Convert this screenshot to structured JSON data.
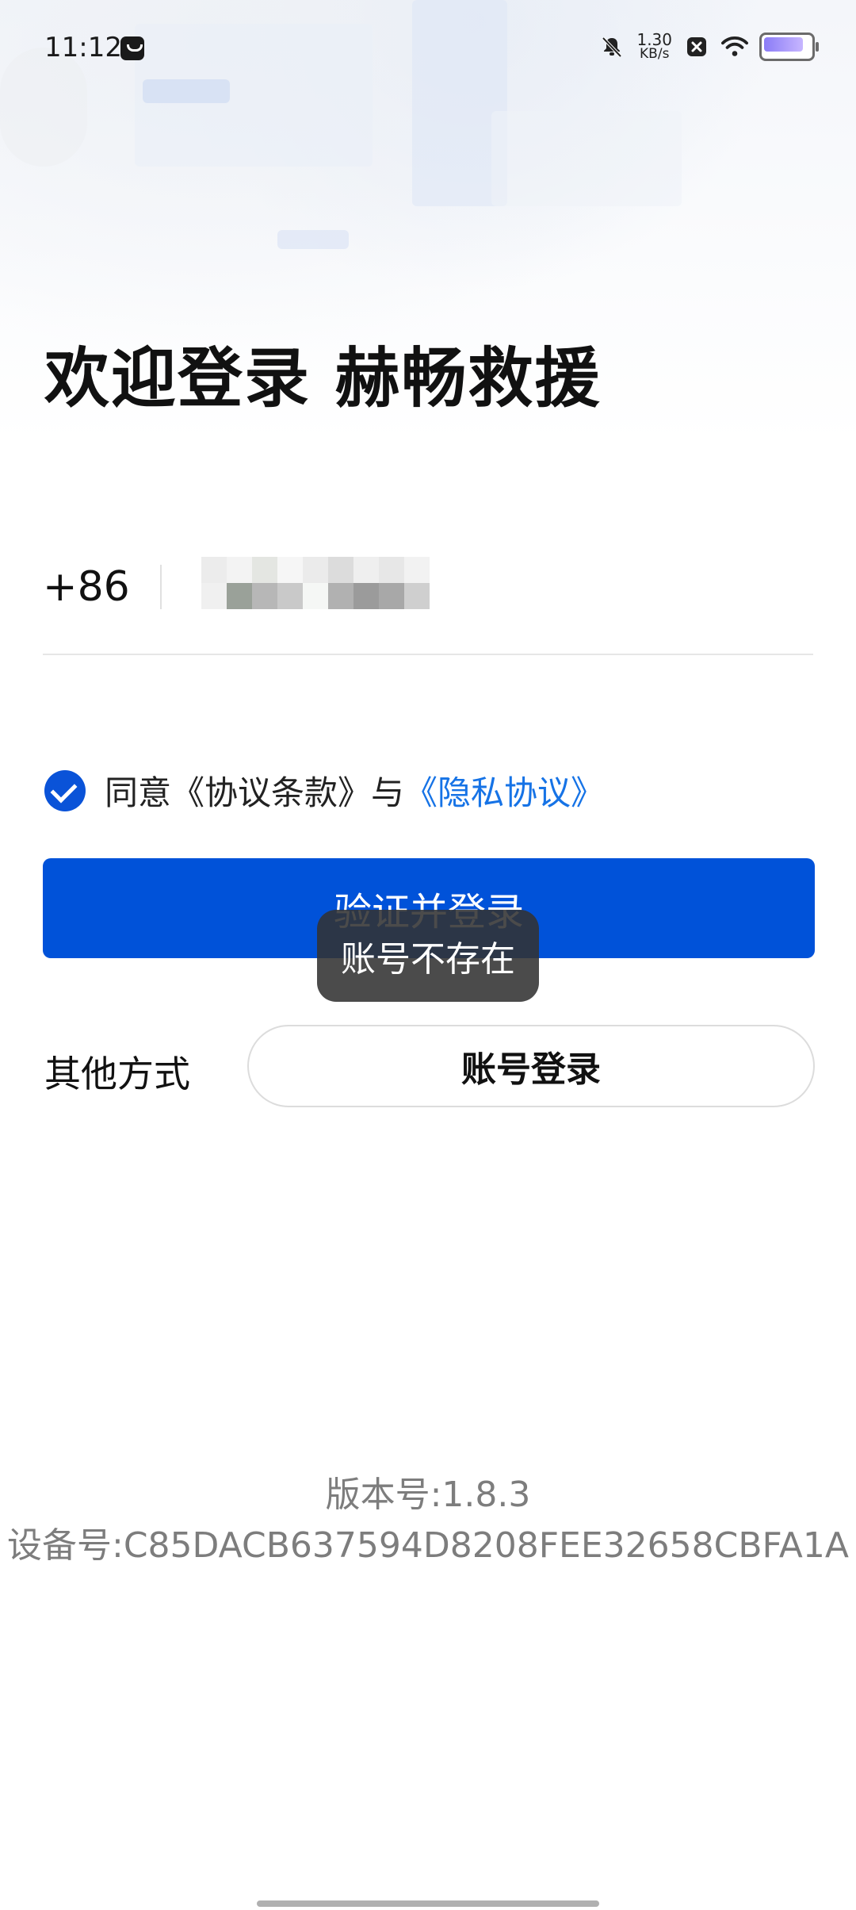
{
  "status_bar": {
    "time": "11:12",
    "net_speed_value": "1.30",
    "net_speed_unit": "KB/s",
    "battery_level": 0.95,
    "icons": [
      "message-icon",
      "mute-bell-icon",
      "close-box-icon",
      "wifi-icon",
      "battery-icon"
    ]
  },
  "page": {
    "title": "欢迎登录 赫畅救援"
  },
  "phone": {
    "country_code": "+86"
  },
  "agreement": {
    "checked": true,
    "prefix": "同意《协议条款》与",
    "privacy_link": "《隐私协议》"
  },
  "login_button": {
    "label": "验证并登录"
  },
  "toast": {
    "message": "账号不存在"
  },
  "other": {
    "label": "其他方式",
    "account_login": "账号登录"
  },
  "footer": {
    "version": "版本号:1.8.3",
    "device": "设备号:C85DACB637594D8208FEE32658CBFA1A"
  },
  "colors": {
    "primary": "#0052d9",
    "link": "#1673e6",
    "check": "#0a53d8",
    "muted_text": "#7d7d7d"
  }
}
